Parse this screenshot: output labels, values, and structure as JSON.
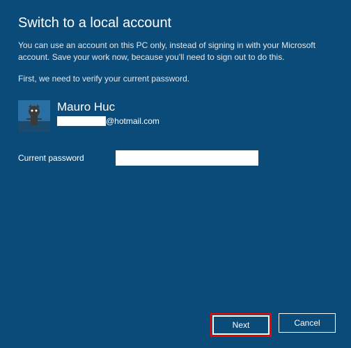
{
  "header": {
    "title": "Switch to a local account",
    "description": "You can use an account on this PC only, instead of signing in with your Microsoft account. Save your work now, because you'll need to sign out to do this.",
    "verify": "First, we need to verify your current password."
  },
  "user": {
    "name": "Mauro Huc",
    "email_domain": "@hotmail.com"
  },
  "form": {
    "password_label": "Current password",
    "password_value": ""
  },
  "buttons": {
    "next": "Next",
    "cancel": "Cancel"
  }
}
